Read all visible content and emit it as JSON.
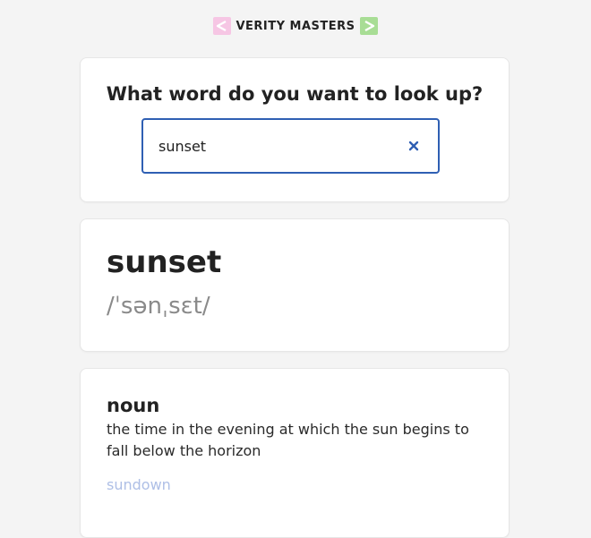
{
  "header": {
    "brand_name": "VERITY MASTERS",
    "colors": {
      "left_chevron": "#f6c6e4",
      "right_chevron": "#a8dd95"
    }
  },
  "search": {
    "question": "What word do you want to look up?",
    "value": "sunset",
    "clear_icon": "close-icon",
    "border_color": "#2f5fb3"
  },
  "result": {
    "word": "sunset",
    "phonetic": "/ˈsənˌsɛt/"
  },
  "meanings": [
    {
      "part_of_speech": "noun",
      "definition": "the time in the evening at which the sun begins to fall below the horizon",
      "synonym": "sundown"
    }
  ]
}
